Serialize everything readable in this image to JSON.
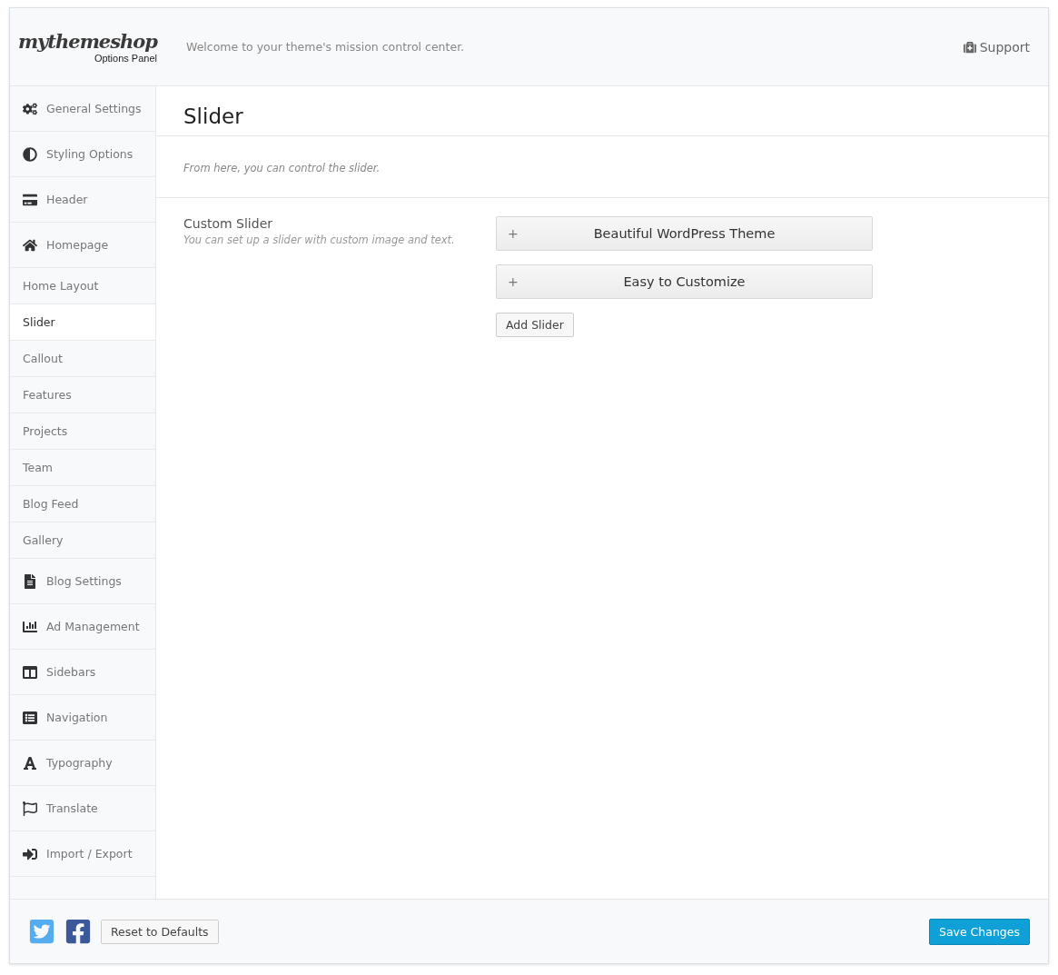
{
  "header": {
    "logo": "mythemeshop",
    "logo_subtitle": "Options Panel",
    "tagline": "Welcome to your theme's mission control center.",
    "support_link": "Support"
  },
  "sidebar": {
    "items": [
      {
        "label": "General Settings",
        "selected": false
      },
      {
        "label": "Styling Options",
        "selected": false
      },
      {
        "label": "Header",
        "selected": false
      },
      {
        "label": "Homepage",
        "selected": false,
        "children": [
          {
            "label": "Home Layout",
            "selected": false
          },
          {
            "label": "Slider",
            "selected": true
          },
          {
            "label": "Callout",
            "selected": false
          },
          {
            "label": "Features",
            "selected": false
          },
          {
            "label": "Projects",
            "selected": false
          },
          {
            "label": "Team",
            "selected": false
          },
          {
            "label": "Blog Feed",
            "selected": false
          },
          {
            "label": "Gallery",
            "selected": false
          }
        ]
      },
      {
        "label": "Blog Settings",
        "selected": false
      },
      {
        "label": "Ad Management",
        "selected": false
      },
      {
        "label": "Sidebars",
        "selected": false
      },
      {
        "label": "Navigation",
        "selected": false
      },
      {
        "label": "Typography",
        "selected": false
      },
      {
        "label": "Translate",
        "selected": false
      },
      {
        "label": "Import / Export",
        "selected": false
      }
    ]
  },
  "content": {
    "title": "Slider",
    "description": "From here, you can control the slider.",
    "option": {
      "label": "Custom Slider",
      "hint": "You can set up a slider with custom image and text.",
      "slides": [
        {
          "toggle": "+",
          "title": "Beautiful WordPress Theme",
          "expanded": false
        },
        {
          "toggle": "+",
          "title": "Easy to Customize",
          "expanded": false
        }
      ],
      "add_button": "Add Slider"
    }
  },
  "footer": {
    "reset_button": "Reset to Defaults",
    "save_button": "Save Changes"
  }
}
